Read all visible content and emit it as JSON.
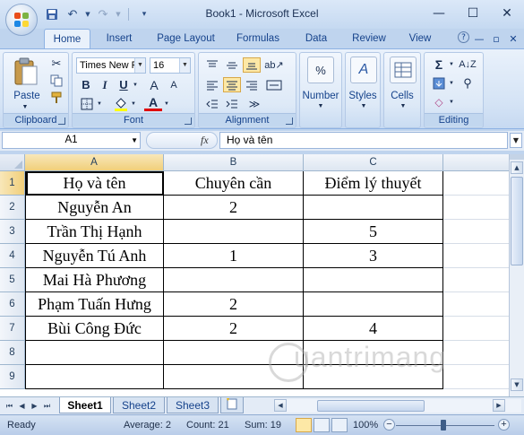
{
  "window": {
    "title": "Book1 - Microsoft Excel"
  },
  "tabs": [
    "Home",
    "Insert",
    "Page Layout",
    "Formulas",
    "Data",
    "Review",
    "View"
  ],
  "ribbon": {
    "paste_label": "Paste",
    "font_name": "Times New Rc",
    "font_size": "16",
    "bold": "B",
    "italic": "I",
    "underline": "U",
    "number_label": "Number",
    "styles_label": "Styles",
    "cells_label": "Cells",
    "groups": {
      "clipboard": "Clipboard",
      "font": "Font",
      "alignment": "Alignment",
      "editing": "Editing"
    }
  },
  "formula_bar": {
    "name_box": "A1",
    "fx": "fx",
    "value": "Họ và tên"
  },
  "sheet": {
    "columns": [
      "A",
      "B",
      "C"
    ],
    "rows": [
      "1",
      "2",
      "3",
      "4",
      "5",
      "6",
      "7",
      "8",
      "9"
    ],
    "cells": [
      [
        "Họ và tên",
        "Chuyên cần",
        "Điểm lý thuyết"
      ],
      [
        "Nguyễn An",
        "2",
        ""
      ],
      [
        "Trần Thị Hạnh",
        "",
        "5"
      ],
      [
        "Nguyễn Tú Anh",
        "1",
        "3"
      ],
      [
        "Mai Hà Phương",
        "",
        ""
      ],
      [
        "Phạm Tuấn Hưng",
        "2",
        ""
      ],
      [
        "Bùi Công Đức",
        "2",
        "4"
      ],
      [
        "",
        "",
        ""
      ],
      [
        "",
        "",
        ""
      ]
    ]
  },
  "sheet_tabs": [
    "Sheet1",
    "Sheet2",
    "Sheet3"
  ],
  "status": {
    "mode": "Ready",
    "average": "Average: 2",
    "count": "Count: 21",
    "sum": "Sum: 19",
    "zoom": "100%"
  },
  "watermark": "uantrimang",
  "icons": [
    "office-logo",
    "save-icon",
    "undo-icon",
    "redo-icon",
    "minimize-icon",
    "maximize-icon",
    "close-icon",
    "help-icon"
  ]
}
